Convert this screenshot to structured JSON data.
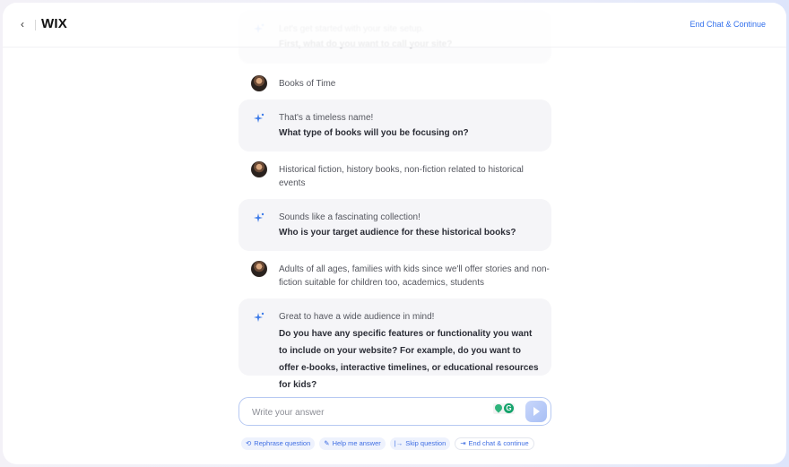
{
  "header": {
    "back_label": "‹",
    "logo": "WIX",
    "end_chat_link": "End Chat & Continue"
  },
  "messages": [
    {
      "role": "assistant",
      "intro": "Let's get started with your site setup.",
      "question": "First, what do you want to call your site?",
      "faded": true
    },
    {
      "role": "user",
      "text": "Books of Time"
    },
    {
      "role": "assistant",
      "intro": "That's a timeless name!",
      "question": "What type of books will you be focusing on?"
    },
    {
      "role": "user",
      "text": "Historical fiction, history books, non-fiction related to historical events"
    },
    {
      "role": "assistant",
      "intro": "Sounds like a fascinating collection!",
      "question": "Who is your target audience for these historical books?"
    },
    {
      "role": "user",
      "text": "Adults of all ages, families with kids since we'll offer stories and non-fiction suitable for children too, academics, students"
    },
    {
      "role": "assistant",
      "intro": "Great to have a wide audience in mind!",
      "question": "Do you have any specific features or functionality you want to include on your website? For example, do you want to offer e-books, interactive timelines, or educational resources for kids?"
    }
  ],
  "composer": {
    "placeholder": "Write your answer",
    "value": "",
    "send_icon": "send-icon",
    "extension_icons": [
      "pin-extension-icon",
      "grammarly-icon"
    ]
  },
  "actions": [
    {
      "icon": "rephrase-icon",
      "glyph": "⟲",
      "label": "Rephrase question"
    },
    {
      "icon": "help-icon",
      "glyph": "✎",
      "label": "Help me answer"
    },
    {
      "icon": "skip-icon",
      "glyph": "|→",
      "label": "Skip question"
    },
    {
      "icon": "exit-icon",
      "glyph": "⇥",
      "label": "End chat & continue"
    }
  ],
  "colors": {
    "accent": "#3370ec",
    "bubble_bg": "#f5f5f8",
    "chip_bg": "#eef2fd"
  }
}
